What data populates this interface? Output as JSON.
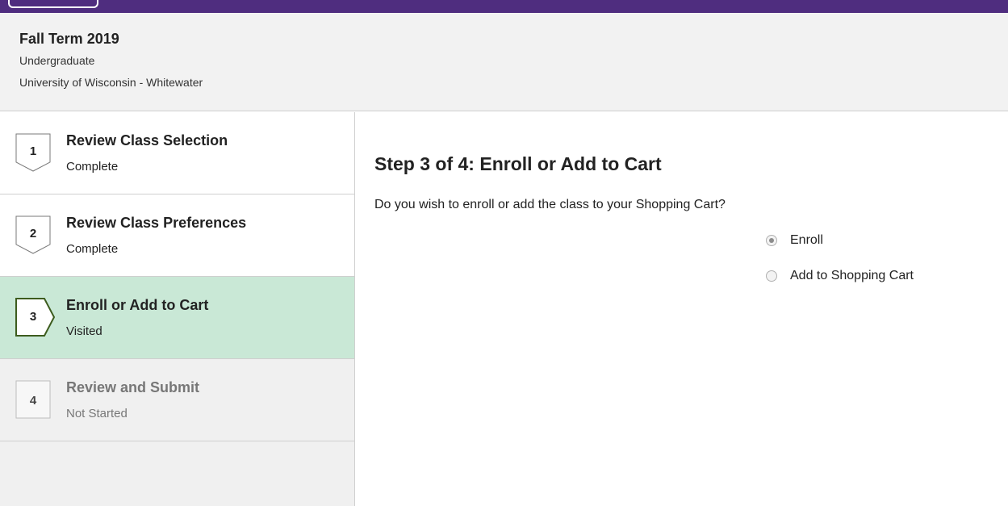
{
  "term": {
    "title": "Fall Term 2019",
    "career": "Undergraduate",
    "institution": "University of Wisconsin - Whitewater"
  },
  "steps": [
    {
      "number": "1",
      "label": "Review Class Selection",
      "status": "Complete"
    },
    {
      "number": "2",
      "label": "Review Class Preferences",
      "status": "Complete"
    },
    {
      "number": "3",
      "label": "Enroll or Add to Cart",
      "status": "Visited"
    },
    {
      "number": "4",
      "label": "Review and Submit",
      "status": "Not Started"
    }
  ],
  "main": {
    "title": "Step 3 of 4: Enroll or Add to Cart",
    "question": "Do you wish to enroll or add the class to your Shopping Cart?",
    "options": [
      {
        "label": "Enroll",
        "selected": true
      },
      {
        "label": "Add to Shopping Cart",
        "selected": false
      }
    ]
  },
  "colors": {
    "brand_bar": "#4f2d7f",
    "active_step_bg": "#c9e8d6",
    "active_step_border": "#3d5c1e"
  }
}
